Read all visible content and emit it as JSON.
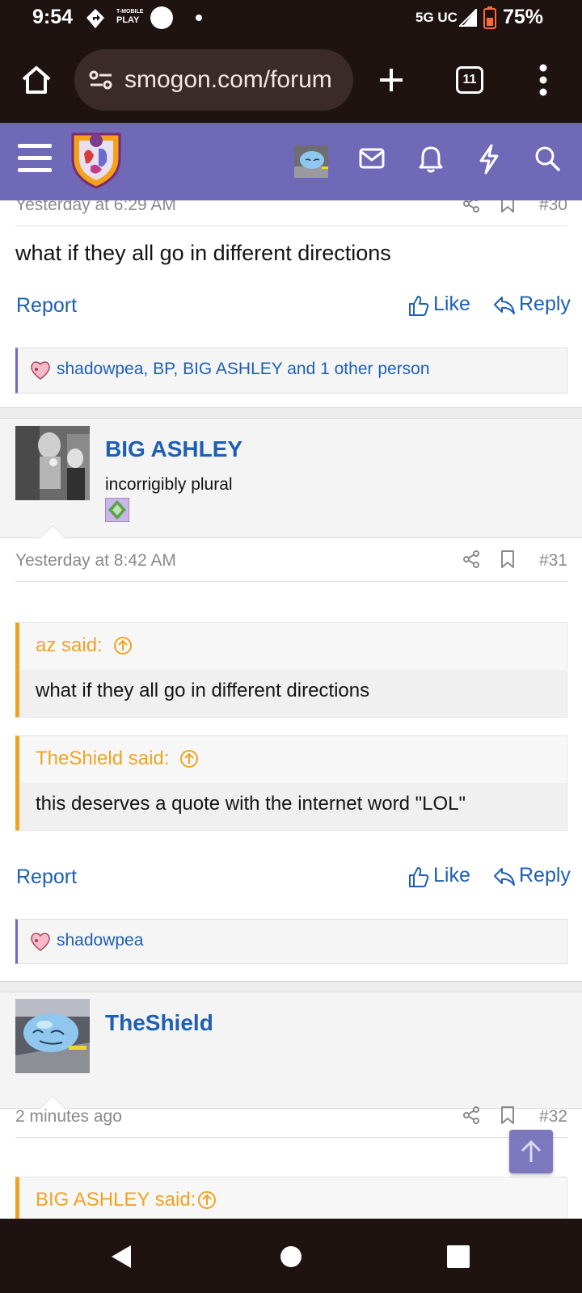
{
  "status_bar": {
    "time": "9:54",
    "carrier_badge_line1": "T-MOBILE",
    "carrier_badge_line2": "PLAY",
    "network": "5G UC",
    "battery": "75%"
  },
  "browser": {
    "url": "smogon.com/forum",
    "tab_count": "11"
  },
  "posts": [
    {
      "date": "Yesterday at 6:29 AM",
      "number": "#30",
      "text": "what if they all go in different directions",
      "report_label": "Report",
      "like_label": "Like",
      "reply_label": "Reply",
      "reactions": "shadowpea, BP, BIG ASHLEY and 1 other person"
    },
    {
      "username": "BIG ASHLEY",
      "user_title": "incorrigibly plural",
      "date": "Yesterday at 8:42 AM",
      "number": "#31",
      "quotes": [
        {
          "author": "az said:",
          "text": "what if they all go in different directions"
        },
        {
          "author": "TheShield said:",
          "text": "this deserves a quote with the internet word \"LOL\""
        }
      ],
      "report_label": "Report",
      "like_label": "Like",
      "reply_label": "Reply",
      "reactions": "shadowpea"
    },
    {
      "username": "TheShield",
      "date": "2 minutes ago",
      "number": "#32",
      "quote_author": "BIG ASHLEY said:"
    }
  ],
  "colors": {
    "accent": "#6f69b8",
    "link": "#1e5fb4",
    "quote": "#f0a323",
    "chrome": "#1f1312"
  }
}
